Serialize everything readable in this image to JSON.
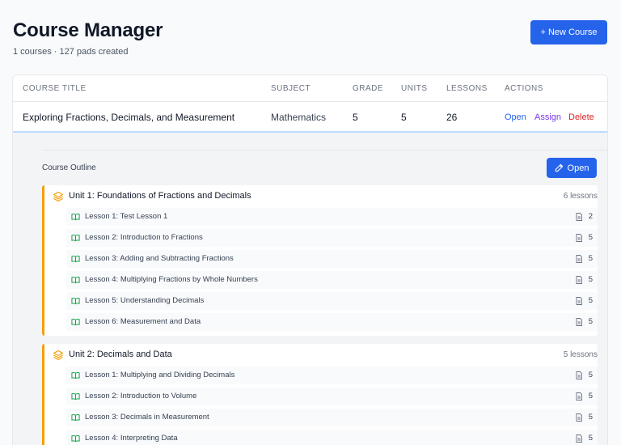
{
  "header": {
    "title": "Course Manager",
    "subtitle": "1 courses · 127 pads created",
    "new_course_label": "+ New Course"
  },
  "table": {
    "columns": [
      "COURSE TITLE",
      "SUBJECT",
      "GRADE",
      "UNITS",
      "LESSONS",
      "ACTIONS"
    ],
    "row": {
      "title": "Exploring Fractions, Decimals, and Measurement",
      "subject": "Mathematics",
      "grade": "5",
      "units": "5",
      "lessons": "26",
      "actions": {
        "open": "Open",
        "assign": "Assign",
        "delete": "Delete"
      }
    }
  },
  "outline": {
    "label": "Course Outline",
    "open_label": "Open",
    "units": [
      {
        "title": "Unit 1: Foundations of Fractions and Decimals",
        "count": "6 lessons",
        "lessons": [
          {
            "title": "Lesson 1: Test Lesson 1",
            "pads": "2"
          },
          {
            "title": "Lesson 2: Introduction to Fractions",
            "pads": "5"
          },
          {
            "title": "Lesson 3: Adding and Subtracting Fractions",
            "pads": "5"
          },
          {
            "title": "Lesson 4: Multiplying Fractions by Whole Numbers",
            "pads": "5"
          },
          {
            "title": "Lesson 5: Understanding Decimals",
            "pads": "5"
          },
          {
            "title": "Lesson 6: Measurement and Data",
            "pads": "5"
          }
        ]
      },
      {
        "title": "Unit 2: Decimals and Data",
        "count": "5 lessons",
        "lessons": [
          {
            "title": "Lesson 1: Multiplying and Dividing Decimals",
            "pads": "5"
          },
          {
            "title": "Lesson 2: Introduction to Volume",
            "pads": "5"
          },
          {
            "title": "Lesson 3: Decimals in Measurement",
            "pads": "5"
          },
          {
            "title": "Lesson 4: Interpreting Data",
            "pads": "5"
          }
        ]
      }
    ]
  },
  "colors": {
    "primary": "#2563eb",
    "assign": "#7c3aed",
    "delete": "#dc2626",
    "unit_accent": "#f59e0b",
    "lesson_icon": "#16a34a"
  },
  "icons": {
    "unit": "layers-icon",
    "lesson": "book-open-icon",
    "pads": "file-icon",
    "open": "pencil-icon"
  }
}
